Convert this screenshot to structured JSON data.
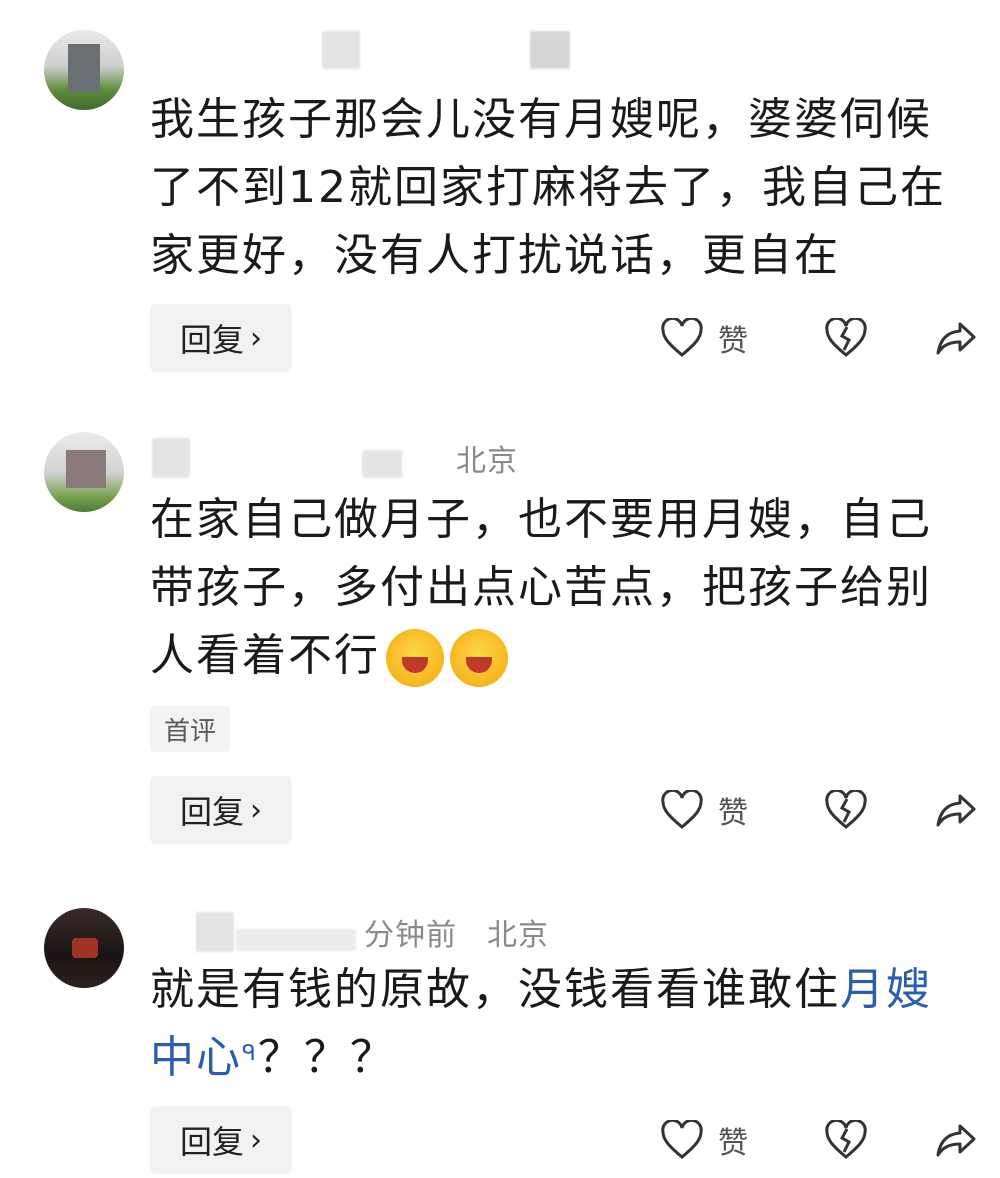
{
  "comments": [
    {
      "location": "",
      "time": "",
      "text": "我生孩子那会儿没有月嫂呢，婆婆伺候了不到12就回家打麻将去了，我自己在家更好，没有人打扰说话，更自在",
      "tag": "",
      "reply_label": "回复",
      "like_label": "赞"
    },
    {
      "location": "北京",
      "time": "",
      "text": "在家自己做月子，也不要用月嫂，自己带孩子，多付出点心苦点，把孩子给别人看着不行",
      "tag": "首评",
      "reply_label": "回复",
      "like_label": "赞"
    },
    {
      "location": "北京",
      "time": "分钟前",
      "text_before_link": "就是有钱的原故，没钱看看谁敢住",
      "link_text": "月嫂中心",
      "text_after_link": "？？？",
      "tag": "",
      "reply_label": "回复",
      "like_label": "赞"
    }
  ],
  "icons": {
    "reply_chevron": "chevron-right-icon",
    "like": "heart-outline-icon",
    "dislike": "broken-heart-icon",
    "share": "share-arrow-icon",
    "search_mark": "search-icon",
    "emoji": "laughing-crying-emoji-icon"
  },
  "colors": {
    "link": "#2a5db0",
    "meta": "#8a8a8a",
    "button_bg": "#f2f2f2"
  }
}
